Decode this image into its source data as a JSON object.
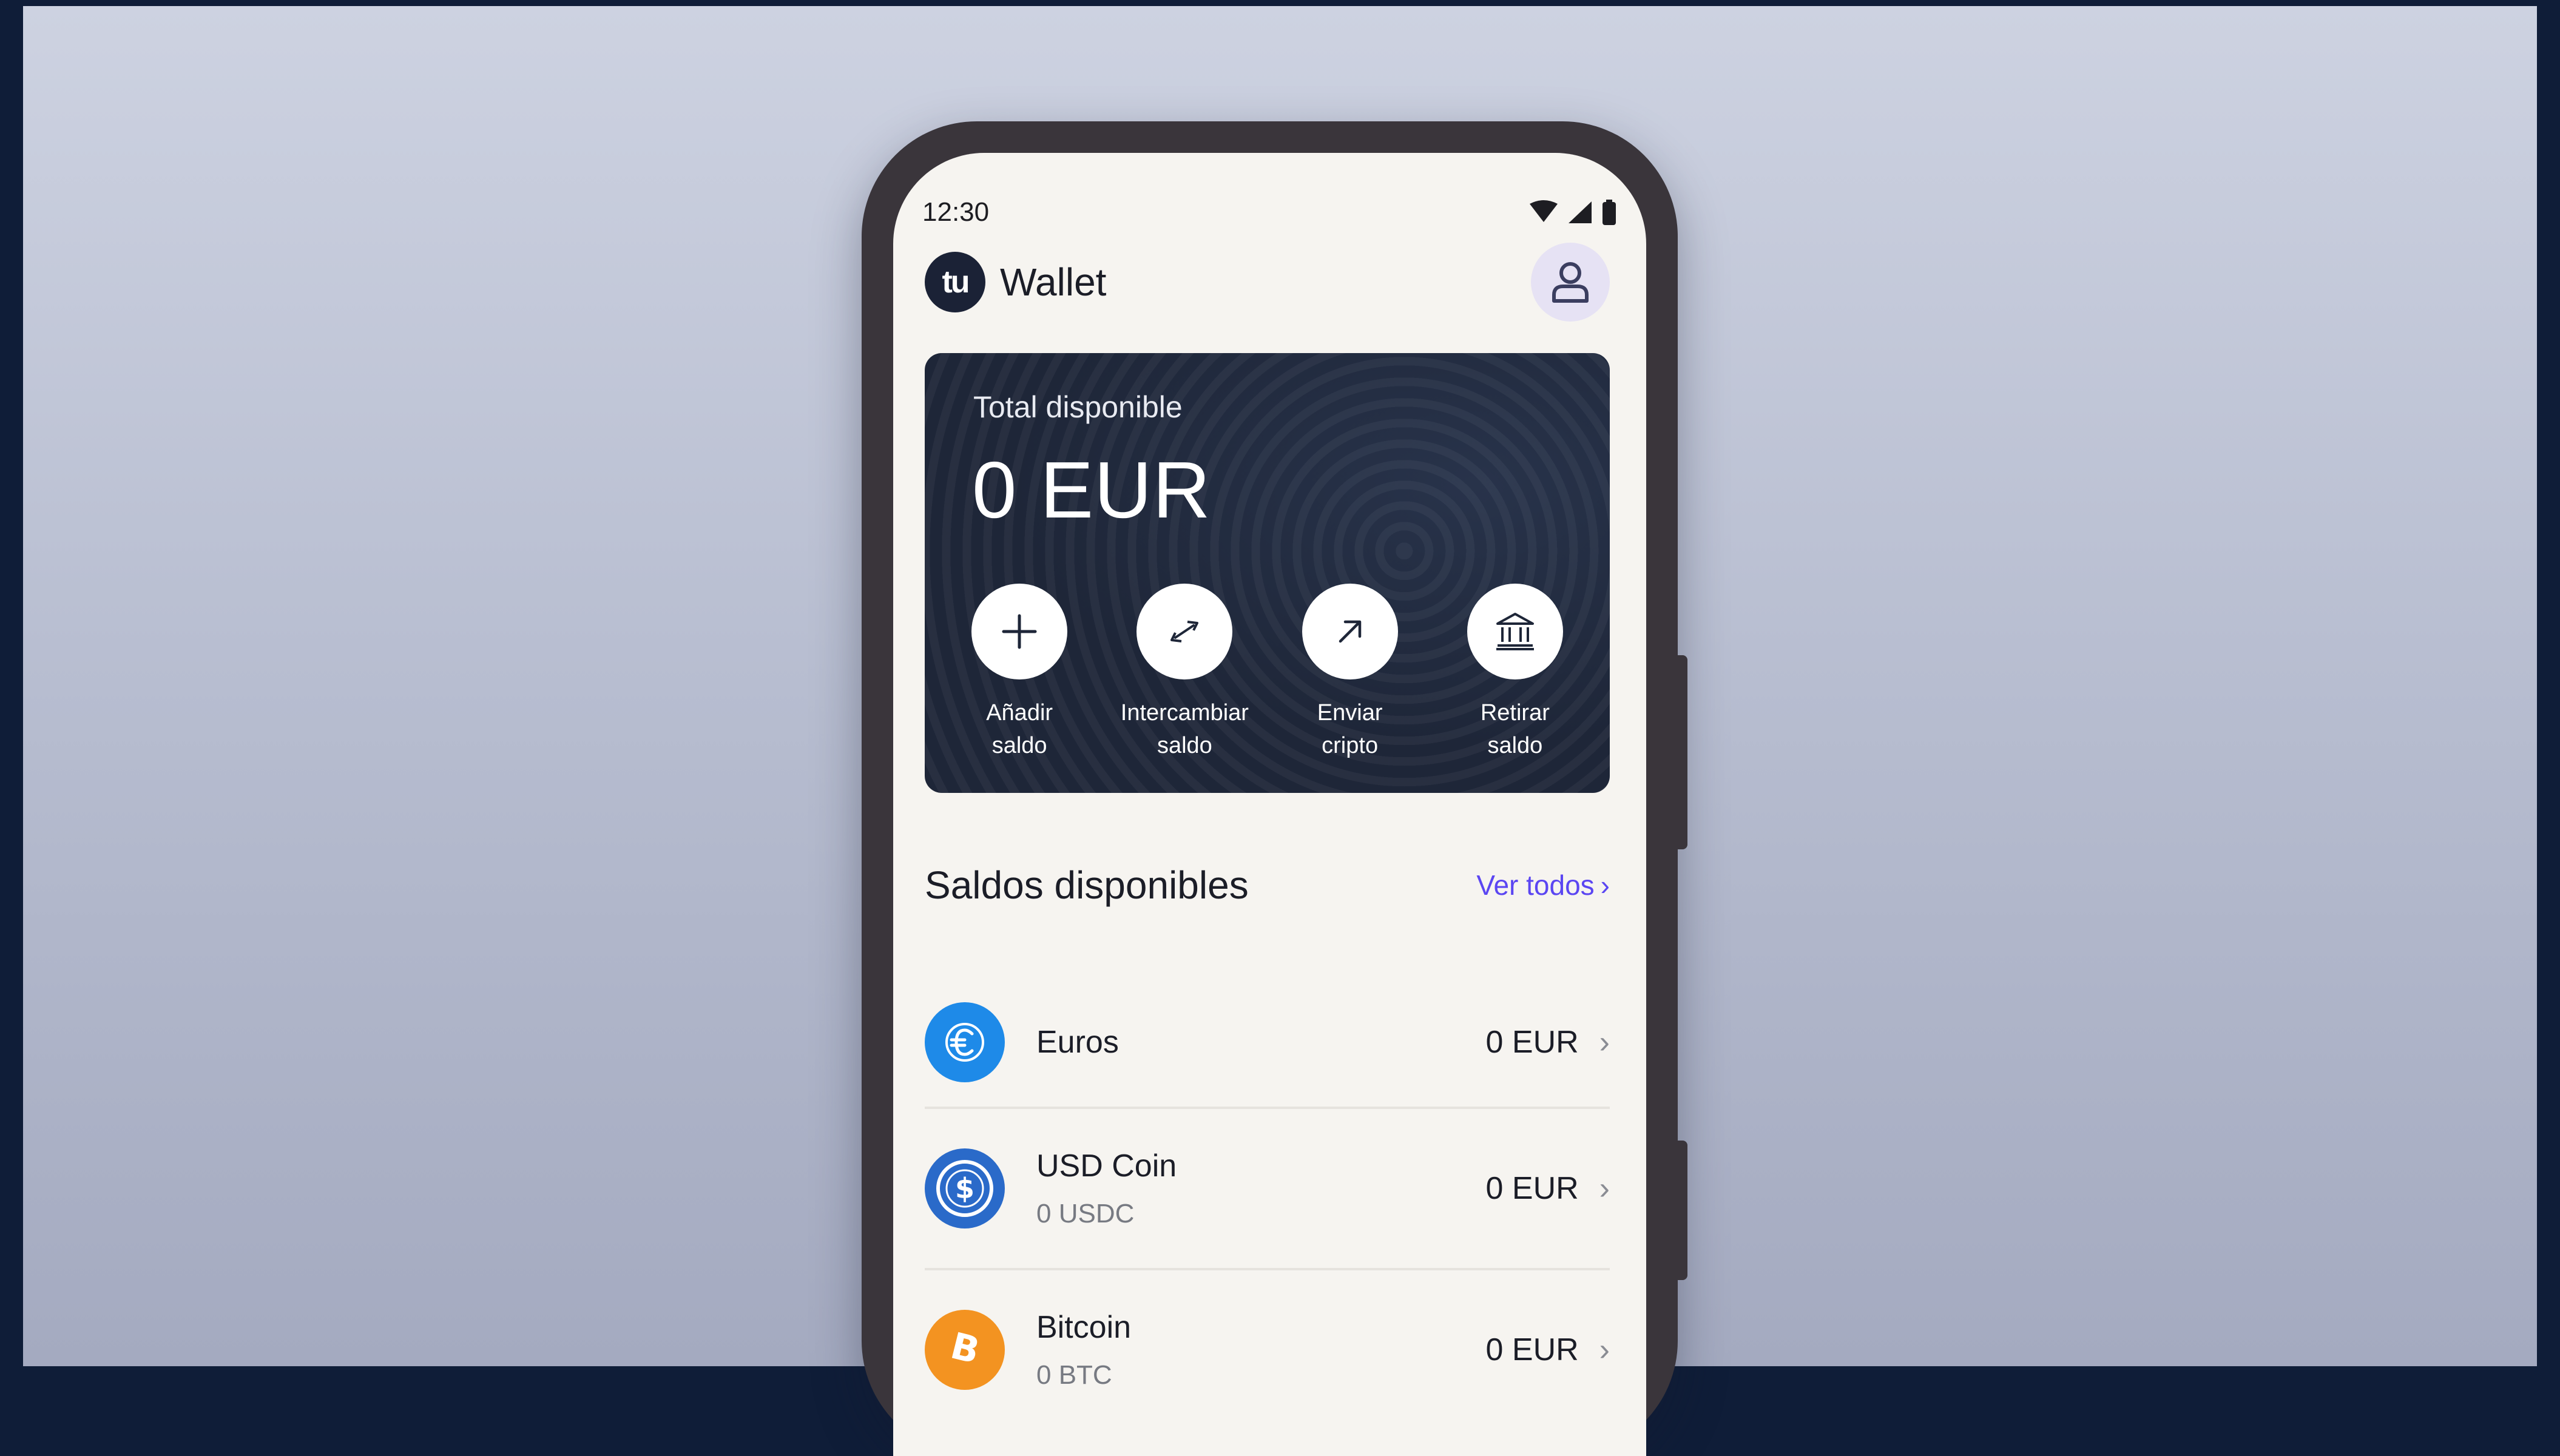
{
  "status_bar": {
    "time": "12:30",
    "icons": [
      "wifi-icon",
      "signal-icon",
      "battery-icon"
    ]
  },
  "header": {
    "logo_text": "tu",
    "title": "Wallet",
    "profile_icon": "user-icon"
  },
  "balance_card": {
    "label": "Total disponible",
    "amount": "0 EUR",
    "actions": [
      {
        "label": "Añadir\nsaldo",
        "icon": "plus-icon"
      },
      {
        "label": "Intercambiar\nsaldo",
        "icon": "swap-icon"
      },
      {
        "label": "Enviar\ncripto",
        "icon": "arrow-up-right-icon"
      },
      {
        "label": "Retirar\nsaldo",
        "icon": "bank-icon"
      }
    ]
  },
  "balances": {
    "title": "Saldos disponibles",
    "see_all": "Ver todos",
    "items": [
      {
        "name": "Euros",
        "sub": "",
        "value": "0 EUR",
        "icon": "euro-icon",
        "color": "#1e8ae8"
      },
      {
        "name": "USD Coin",
        "sub": "0 USDC",
        "value": "0 EUR",
        "icon": "usdc-icon",
        "color": "#2a6ac9"
      },
      {
        "name": "Bitcoin",
        "sub": "0 BTC",
        "value": "0 EUR",
        "icon": "bitcoin-icon",
        "color": "#f39321"
      }
    ]
  },
  "colors": {
    "accent": "#5b46f2",
    "card_bg": "#1e2638",
    "screen_bg": "#f6f4f0"
  }
}
